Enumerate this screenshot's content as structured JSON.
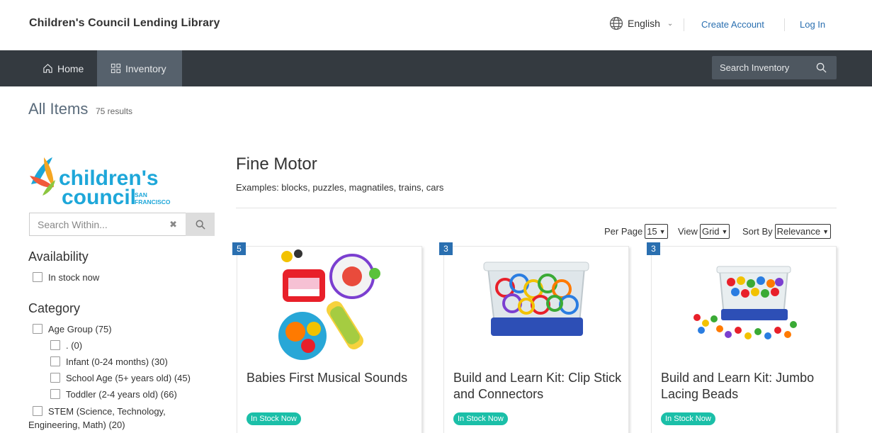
{
  "header": {
    "brand": "Children's Council Lending Library",
    "language": "English",
    "create_account": "Create Account",
    "login": "Log In"
  },
  "nav": {
    "home": "Home",
    "inventory": "Inventory",
    "search_placeholder": "Search Inventory"
  },
  "page": {
    "title": "All Items",
    "results": "75 results"
  },
  "sidebar": {
    "logo_text_1": "children's",
    "logo_text_2": "council",
    "logo_sub_1": "SAN",
    "logo_sub_2": "FRANCISCO",
    "search_placeholder": "Search Within...",
    "availability_heading": "Availability",
    "in_stock": "In stock now",
    "category_heading": "Category",
    "categories": [
      "Age Group (75)",
      ". (0)",
      "Infant (0-24 months) (30)",
      "School Age (5+ years old) (45)",
      "Toddler (2-4 years old) (66)",
      "STEM (Science, Technology,",
      "Engineering, Math) (20)"
    ]
  },
  "main": {
    "category_title": "Fine Motor",
    "category_desc": "Examples: blocks, puzzles, magnatiles, trains, cars",
    "per_page_label": "Per Page",
    "per_page_value": "15",
    "view_label": "View",
    "view_value": "Grid",
    "sort_label": "Sort By",
    "sort_value": "Relevance"
  },
  "items": [
    {
      "count": "5",
      "title": "Babies First Musical Sounds",
      "status": "In Stock Now"
    },
    {
      "count": "3",
      "title": "Build and Learn Kit: Clip Stick and Connectors",
      "status": "In Stock Now"
    },
    {
      "count": "3",
      "title": "Build and Learn Kit: Jumbo Lacing Beads",
      "status": "In Stock Now"
    }
  ],
  "colors": {
    "nav_bg": "#343a40",
    "nav_active": "#56616c",
    "link": "#2a6fb0",
    "badge": "#2a6fb0",
    "stock": "#1bbfa8"
  }
}
